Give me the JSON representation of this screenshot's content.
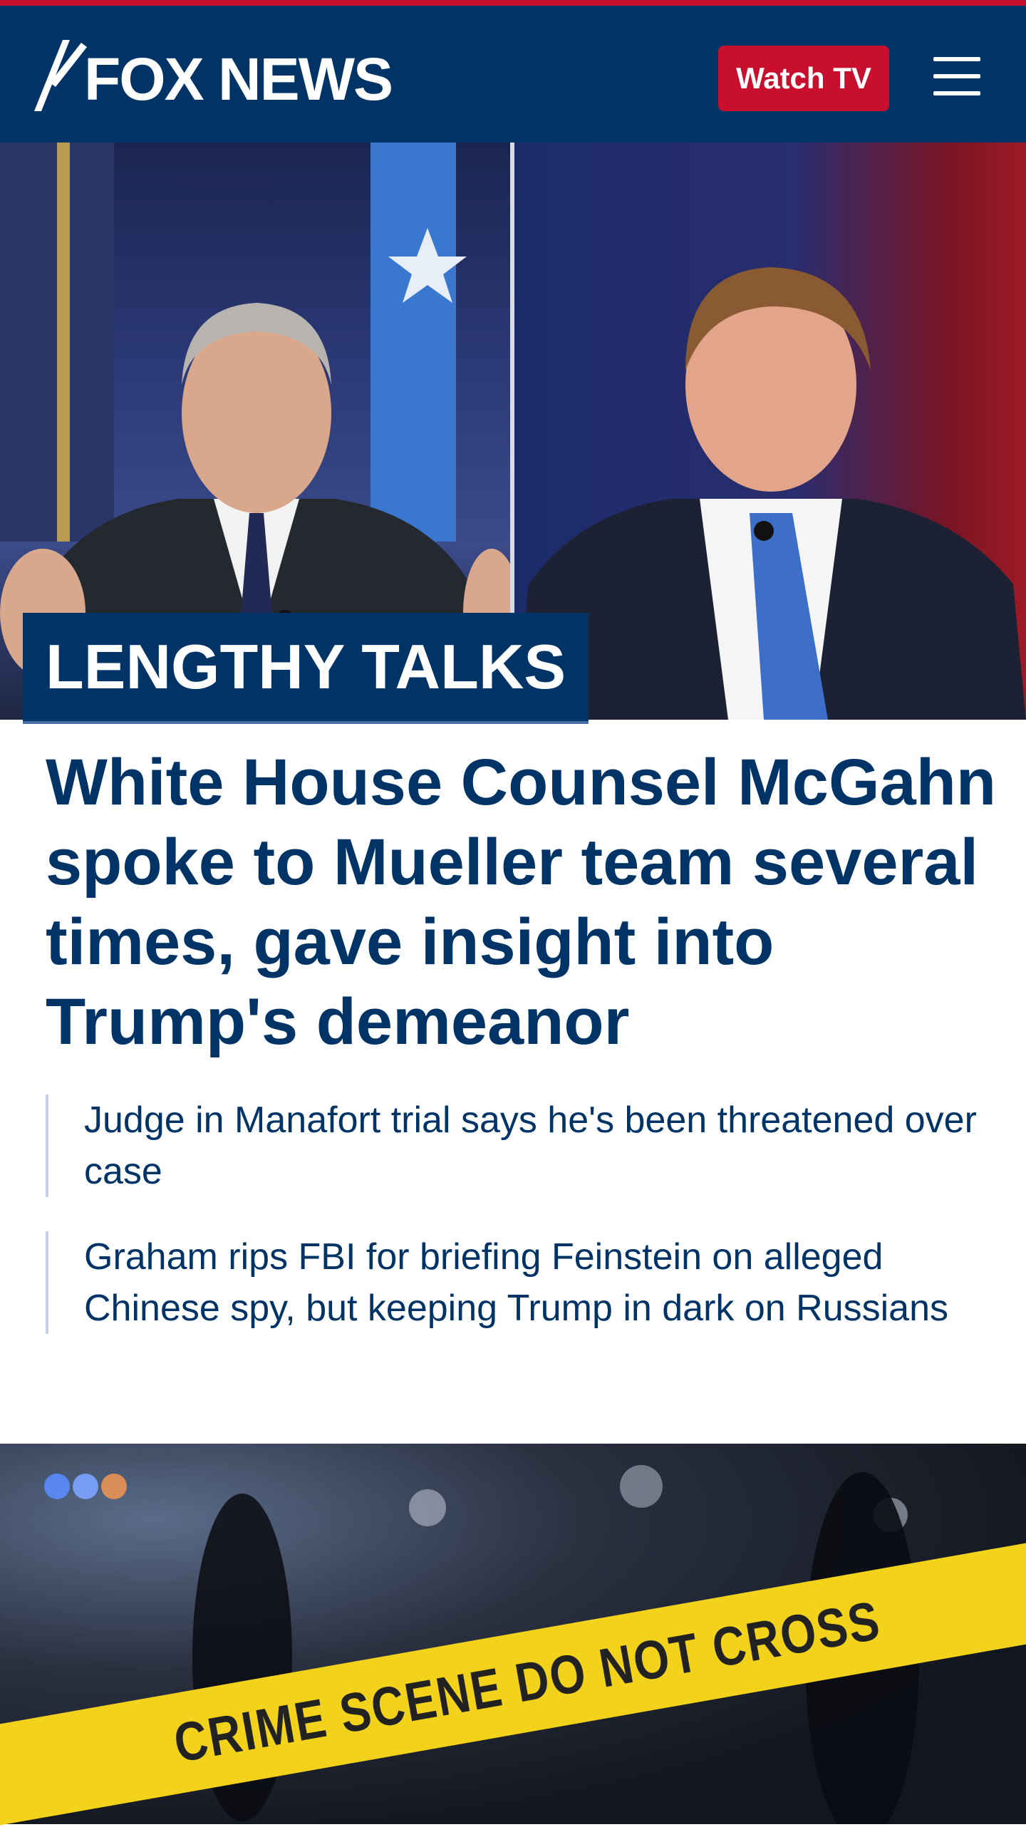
{
  "header": {
    "logo_text": "FOX NEWS",
    "watch_label": "Watch TV",
    "brand_colors": {
      "navy": "#003366",
      "red": "#c8102e"
    }
  },
  "lead_story": {
    "kicker": "LENGTHY TALKS",
    "headline": "White House Counsel McGahn spoke to Mueller team several times, gave insight into Trump's demeanor",
    "related": [
      "Judge in Manafort trial says he's been threatened over case",
      "Graham rips FBI for briefing Feinstein on alleged Chinese spy, but keeping Trump in dark on Russians"
    ]
  },
  "second_story": {
    "tape_text": "CRIME SCENE DO NOT CROSS"
  }
}
